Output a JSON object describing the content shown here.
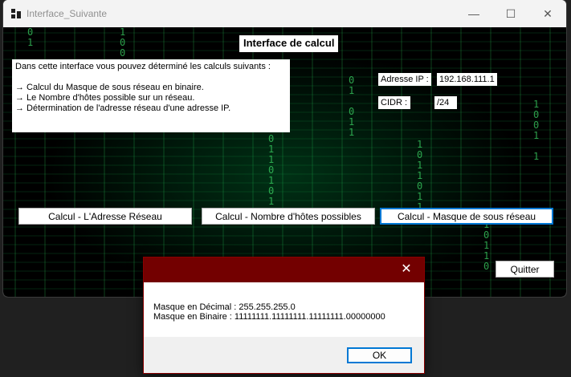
{
  "window": {
    "title": "Interface_Suivante"
  },
  "main": {
    "section_title": "Interface de calcul",
    "info_lines": [
      "Dans cette interface vous pouvez déterminé les calculs suivants :",
      "",
      "→ Calcul du Masque de sous réseau en binaire.",
      "→ Le Nombre d'hôtes possible sur un réseau.",
      "→ Détermination de l'adresse réseau d'une adresse IP."
    ],
    "ip_label": "Adresse IP :",
    "ip_value": "192.168.111.1",
    "cidr_label": "CIDR :",
    "cidr_value": "/24",
    "buttons": {
      "network_address": "Calcul - L'Adresse Réseau",
      "hosts_count": "Calcul - Nombre d'hôtes possibles",
      "subnet_mask": "Calcul - Masque de sous réseau"
    },
    "quit_label": "Quitter"
  },
  "dialog": {
    "line1": "Masque en Décimal : 255.255.255.0",
    "line2": "Masque en Binaire : 11111111.11111111.11111111.00000000",
    "ok_label": "OK"
  },
  "colors": {
    "dialog_title": "#730000",
    "matrix_green": "#3fe06a"
  },
  "icons": [
    "app-icon",
    "minimize-icon",
    "maximize-icon",
    "close-icon"
  ]
}
